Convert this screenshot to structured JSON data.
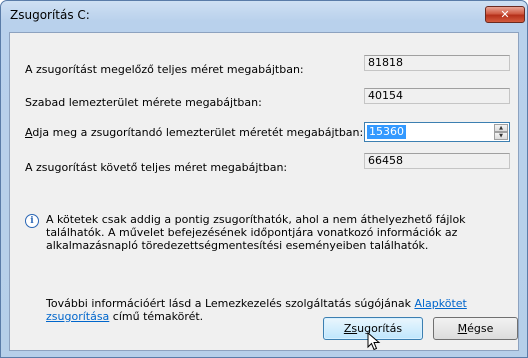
{
  "dialog": {
    "title": "Zsugorítás C:",
    "close_symbol": "✕"
  },
  "fields": {
    "total_before_label": "A zsugorítást megelőző teljes méret megabájtban:",
    "total_before_value": "81818",
    "free_space_label": "Szabad lemezterület mérete megabájtban:",
    "free_space_value": "40154",
    "shrink_amount_label_accel": "A",
    "shrink_amount_label_rest": "dja meg a zsugorítandó lemezterület méretét megabájtban:",
    "shrink_amount_value": "15360",
    "total_after_label": "A zsugorítást követő teljes méret megabájtban:",
    "total_after_value": "66458"
  },
  "info": {
    "icon": "info-icon",
    "text": "A kötetek csak addig a pontig zsugoríthatók, ahol a nem áthelyezhető fájlok találhatók. A művelet befejezésének időpontjára vonatkozó információk az alkalmazásnapló töredezettségmentesítési eseményeiben találhatók."
  },
  "more": {
    "text_before": "További információért lásd a Lemezkezelés szolgáltatás súgójának ",
    "link_text": "Alapkötet zsugorítása",
    "text_after": " című témakörét."
  },
  "buttons": {
    "shrink_accel": "Zs",
    "shrink_rest": "ugorítás",
    "cancel_accel": "M",
    "cancel_rest": "égse"
  }
}
